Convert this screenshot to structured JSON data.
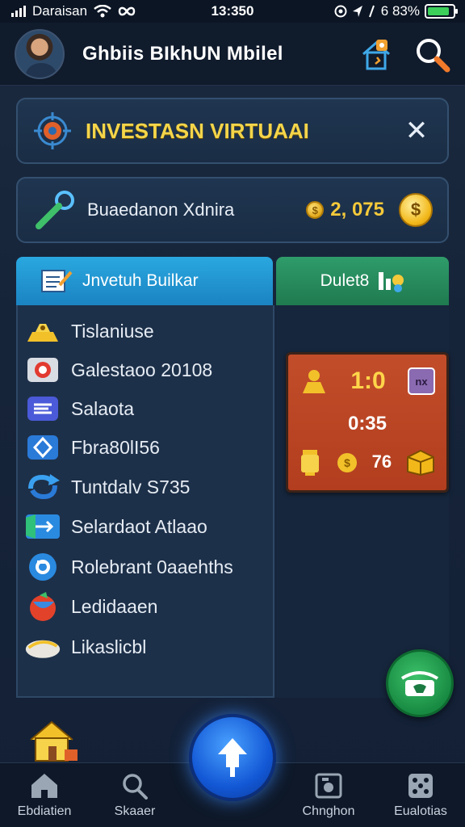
{
  "status_bar": {
    "carrier": "Daraisan",
    "time": "13:350",
    "battery": "6 83%",
    "battery_level": 0.88
  },
  "header": {
    "title": "Ghbiis BIkhUN Mbilel"
  },
  "banner": {
    "title": "INVESTASN VIRTUAAI",
    "close_label": "✕"
  },
  "balance": {
    "label": "Buaedanon Xdnira",
    "amount": "2, 075",
    "coin_symbol": "$"
  },
  "tabs": [
    {
      "label": "Jnvetuh Builkar"
    },
    {
      "label": "Dulet8"
    }
  ],
  "list_items": [
    {
      "label": "Tislaniuse",
      "icon": "stacked-gold-icon"
    },
    {
      "label": "Galestaoo 20108",
      "icon": "record-button-icon"
    },
    {
      "label": "Salaota",
      "icon": "blue-card-icon"
    },
    {
      "label": "Fbra80lI56",
      "icon": "diamond-icon"
    },
    {
      "label": "Tuntdalv S735",
      "icon": "refresh-icon"
    },
    {
      "label": "Selardaot Atlaao",
      "icon": "arrow-board-icon"
    },
    {
      "label": "Rolebrant 0aaehths",
      "icon": "blue-circle-icon"
    },
    {
      "label": "Ledidaaen",
      "icon": "colorful-ball-icon"
    },
    {
      "label": "Likaslicbl",
      "icon": "white-stone-icon"
    }
  ],
  "game_widget": {
    "score": "1:0",
    "badge": "nx",
    "timer": "0:35",
    "count": "76"
  },
  "bottom_nav": [
    {
      "label": "Ebdiatien",
      "icon": "home-icon"
    },
    {
      "label": "Skaaer",
      "icon": "search-icon"
    },
    {
      "label": "Chnghon",
      "icon": "camera-frame-icon"
    },
    {
      "label": "Eualotias",
      "icon": "dice-icon"
    }
  ],
  "colors": {
    "accent_yellow": "#f4d54a",
    "tab_blue": "#2aa8e0",
    "tab_green": "#2f9c6a",
    "widget_red": "#c24d2a",
    "background": "#16243a"
  }
}
